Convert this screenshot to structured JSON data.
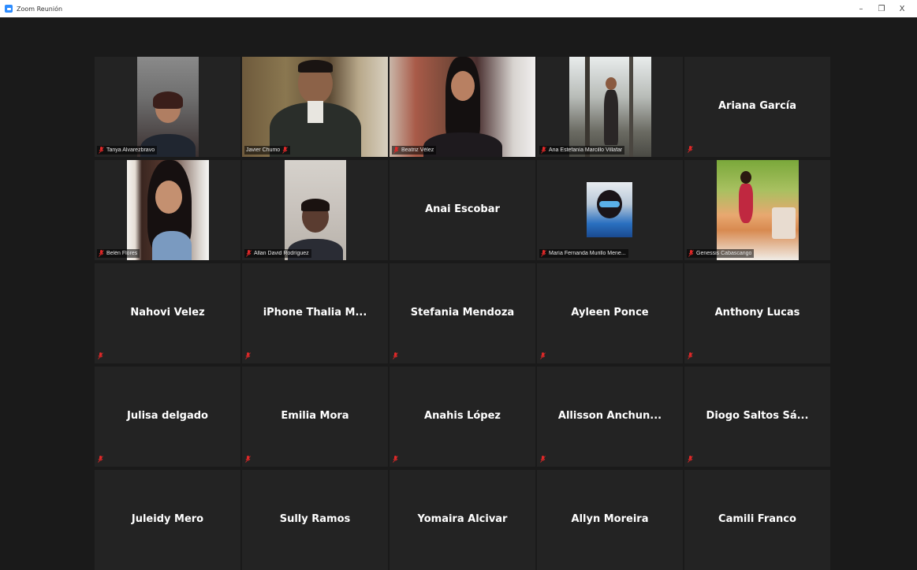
{
  "window": {
    "title": "Zoom Reunión",
    "minimize_glyph": "–",
    "restore_glyph": "❐",
    "close_glyph": "X"
  },
  "participants": [
    {
      "name": "Tanya Alvarezbravo",
      "video": true,
      "muted": true
    },
    {
      "name": "Javier Chumo",
      "video": true,
      "muted": true,
      "active_speaker": true
    },
    {
      "name": "Beatriz Vélez",
      "video": true,
      "muted": true
    },
    {
      "name": "Ana Estefanía Marcillo Villafar",
      "video": true,
      "muted": true
    },
    {
      "name": "Ariana García",
      "video": false,
      "muted": true
    },
    {
      "name": "Belén Flores",
      "video": true,
      "muted": true
    },
    {
      "name": "Allan David Rodríguez",
      "video": true,
      "muted": true
    },
    {
      "name": "Anai Escobar",
      "video": false,
      "muted": false
    },
    {
      "name": "María Fernanda Murillo Mene...",
      "video": true,
      "muted": true
    },
    {
      "name": "Genessis Cabascango",
      "video": true,
      "muted": true
    },
    {
      "name": "Nahovi Velez",
      "video": false,
      "muted": true
    },
    {
      "name": "iPhone Thalia M...",
      "video": false,
      "muted": true
    },
    {
      "name": "Stefania Mendoza",
      "video": false,
      "muted": true
    },
    {
      "name": "Ayleen Ponce",
      "video": false,
      "muted": true
    },
    {
      "name": "Anthony Lucas",
      "video": false,
      "muted": true
    },
    {
      "name": "Julisa delgado",
      "video": false,
      "muted": true
    },
    {
      "name": "Emilia Mora",
      "video": false,
      "muted": true
    },
    {
      "name": "Anahis López",
      "video": false,
      "muted": true
    },
    {
      "name": "Allisson  Anchun...",
      "video": false,
      "muted": true
    },
    {
      "name": "Diogo Saltos Sá...",
      "video": false,
      "muted": true
    },
    {
      "name": "Juleidy Mero",
      "video": false,
      "muted": false
    },
    {
      "name": "Sully Ramos",
      "video": false,
      "muted": false
    },
    {
      "name": "Yomaira Alcivar",
      "video": false,
      "muted": false
    },
    {
      "name": "Allyn Moreira",
      "video": false,
      "muted": false
    },
    {
      "name": "Camili Franco",
      "video": false,
      "muted": false
    }
  ],
  "colors": {
    "background": "#1a1a1a",
    "tile": "#232323",
    "active_speaker_border": "#d8d87a",
    "muted_icon": "#e02828",
    "zoom_blue": "#2d8cff"
  }
}
